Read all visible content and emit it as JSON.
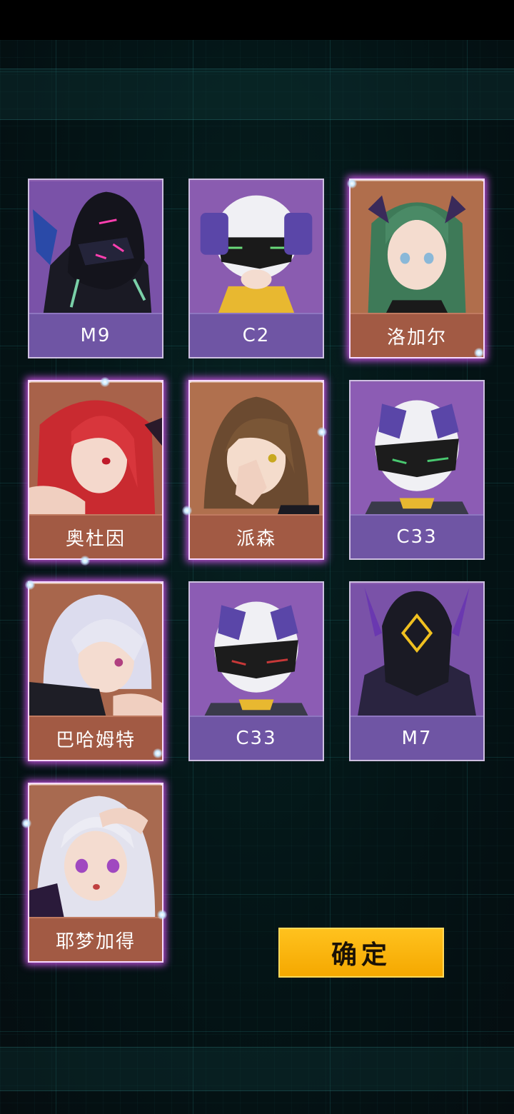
{
  "characters": [
    {
      "name": "M9",
      "theme": "purple",
      "selected": false
    },
    {
      "name": "C2",
      "theme": "purple",
      "selected": false
    },
    {
      "name": "洛加尔",
      "theme": "orange",
      "selected": true
    },
    {
      "name": "奥杜因",
      "theme": "orange",
      "selected": true
    },
    {
      "name": "派森",
      "theme": "orange",
      "selected": true
    },
    {
      "name": "C33",
      "theme": "purple",
      "selected": false
    },
    {
      "name": "巴哈姆特",
      "theme": "orange",
      "selected": true
    },
    {
      "name": "C33",
      "theme": "purple",
      "selected": false
    },
    {
      "name": "M7",
      "theme": "purple",
      "selected": false
    },
    {
      "name": "耶梦加得",
      "theme": "orange",
      "selected": true
    }
  ],
  "confirm_label": "确定",
  "colors": {
    "accent": "#f5a800",
    "purple_card": "#6f55a4",
    "orange_card": "#a25a44",
    "selection_glow": "#e25aff"
  }
}
